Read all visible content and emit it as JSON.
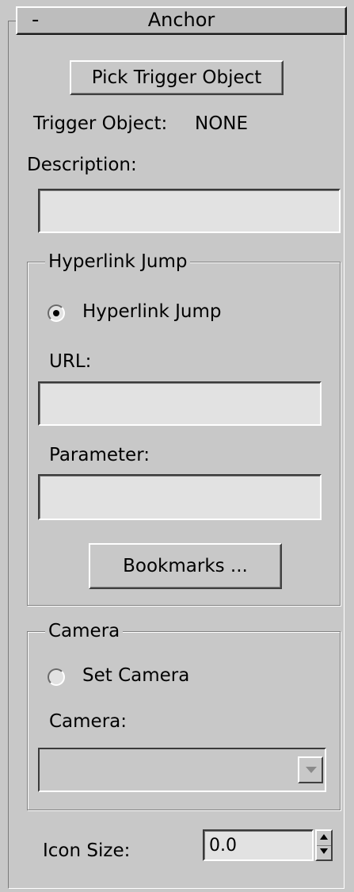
{
  "rollout": {
    "title": "Anchor",
    "collapse_symbol": "-",
    "pick_button_label": "Pick Trigger Object",
    "trigger_object_label": "Trigger Object:",
    "trigger_object_value": "NONE",
    "description_label": "Description:",
    "description_value": ""
  },
  "hyperlink_group": {
    "legend": "Hyperlink Jump",
    "radio_label": "Hyperlink Jump",
    "radio_checked": true,
    "url_label": "URL:",
    "url_value": "",
    "parameter_label": "Parameter:",
    "parameter_value": "",
    "bookmarks_label": "Bookmarks ..."
  },
  "camera_group": {
    "legend": "Camera",
    "radio_label": "Set Camera",
    "radio_checked": false,
    "camera_label": "Camera:",
    "camera_selected": ""
  },
  "icon_size": {
    "label": "Icon Size:",
    "value": "0.0"
  }
}
